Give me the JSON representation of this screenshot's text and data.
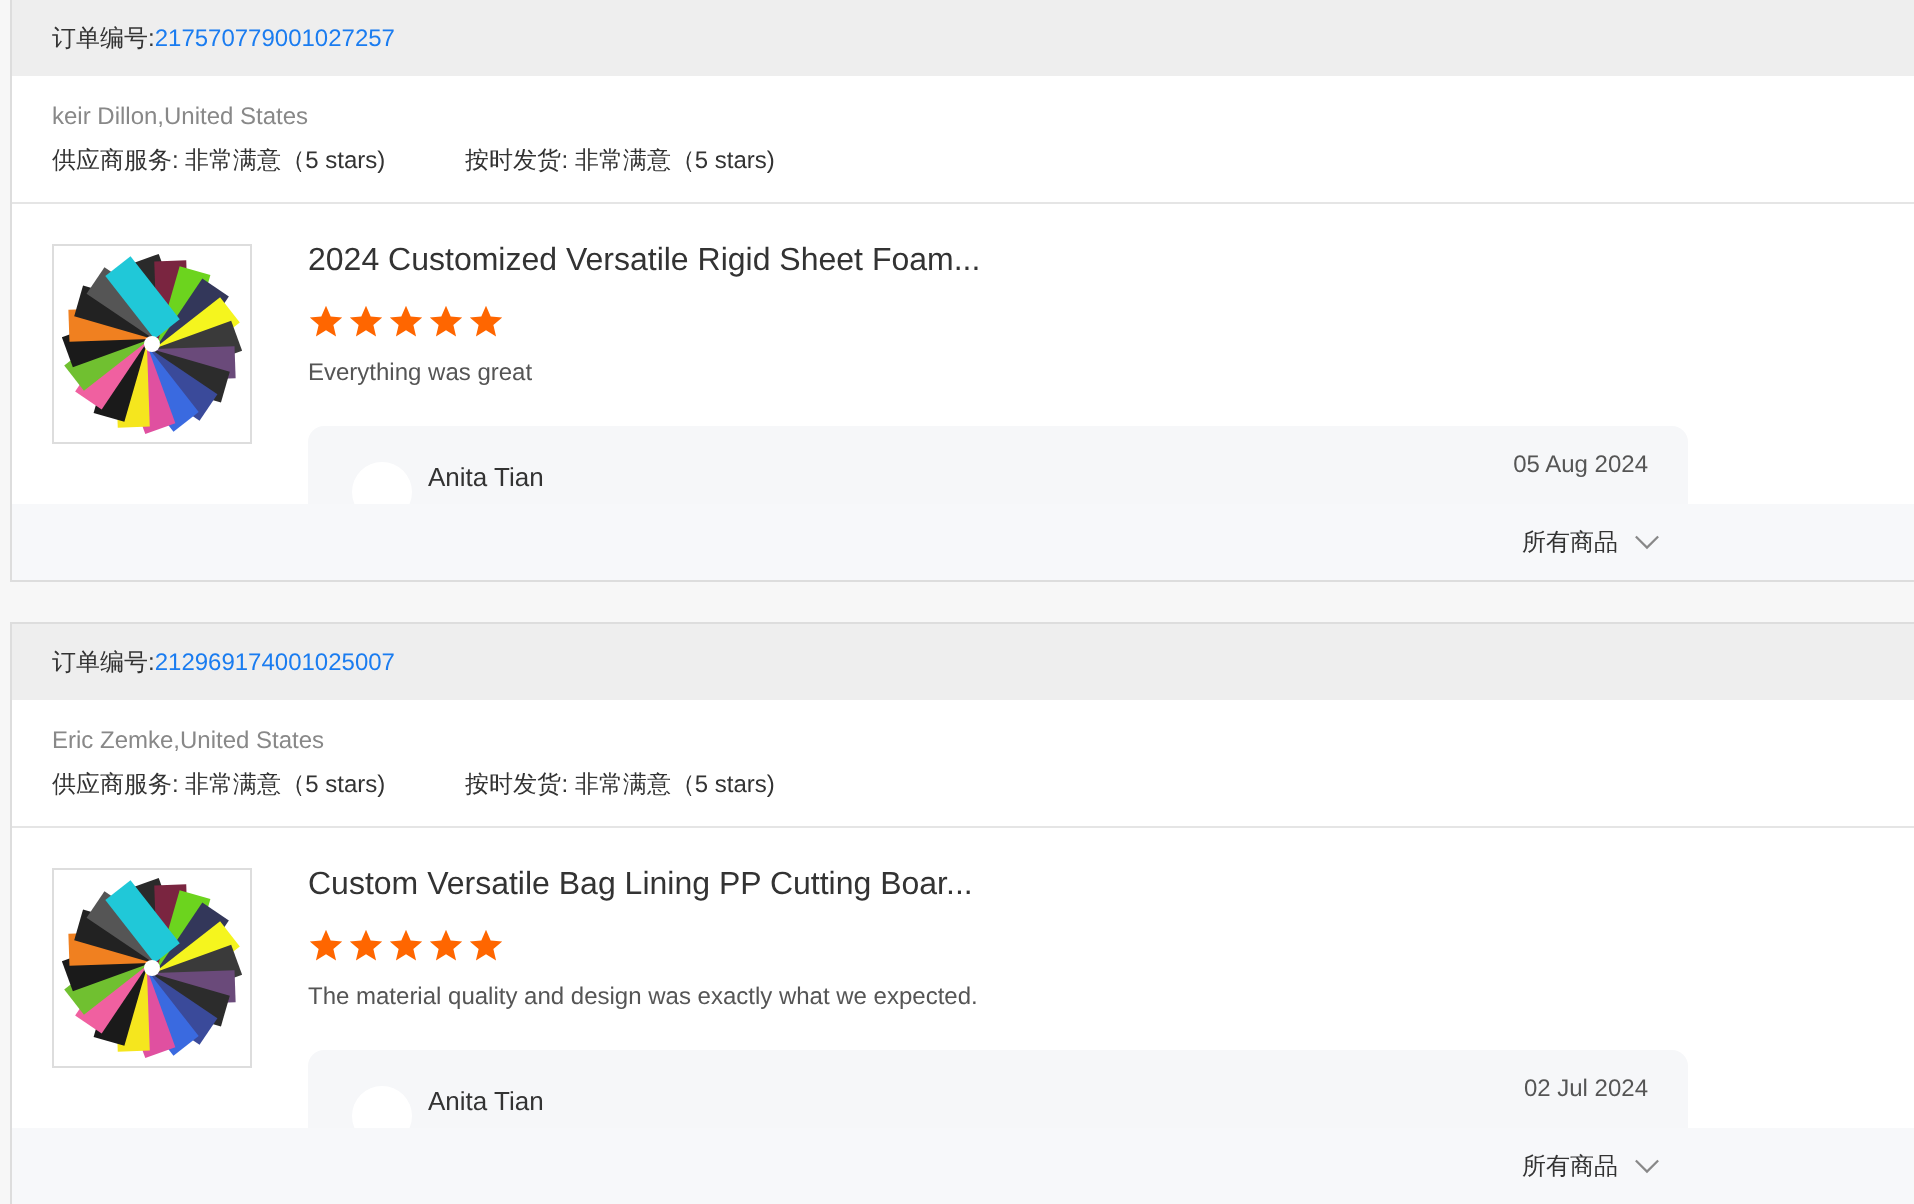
{
  "orders": [
    {
      "order_label": "订单编号:",
      "order_number": "217570779001027257",
      "buyer": "keir Dillon,United States",
      "ratings": [
        "供应商服务: 非常满意（5 stars)",
        "按时发货: 非常满意（5 stars)"
      ],
      "product": {
        "title": "2024 Customized Versatile Rigid Sheet Foam...",
        "stars": 5,
        "review": "Everything was great"
      },
      "reply": {
        "name": "Anita Tian",
        "date": "05 Aug 2024"
      },
      "footer_label": "所有商品"
    },
    {
      "order_label": "订单编号:",
      "order_number": "212969174001025007",
      "buyer": "Eric Zemke,United States",
      "ratings": [
        "供应商服务: 非常满意（5 stars)",
        "按时发货: 非常满意（5 stars)"
      ],
      "product": {
        "title": "Custom Versatile Bag Lining PP Cutting Boar...",
        "stars": 5,
        "review": "The material quality and design was exactly what we expected."
      },
      "reply": {
        "name": "Anita Tian",
        "date": "02 Jul 2024"
      },
      "footer_label": "所有商品"
    }
  ]
}
